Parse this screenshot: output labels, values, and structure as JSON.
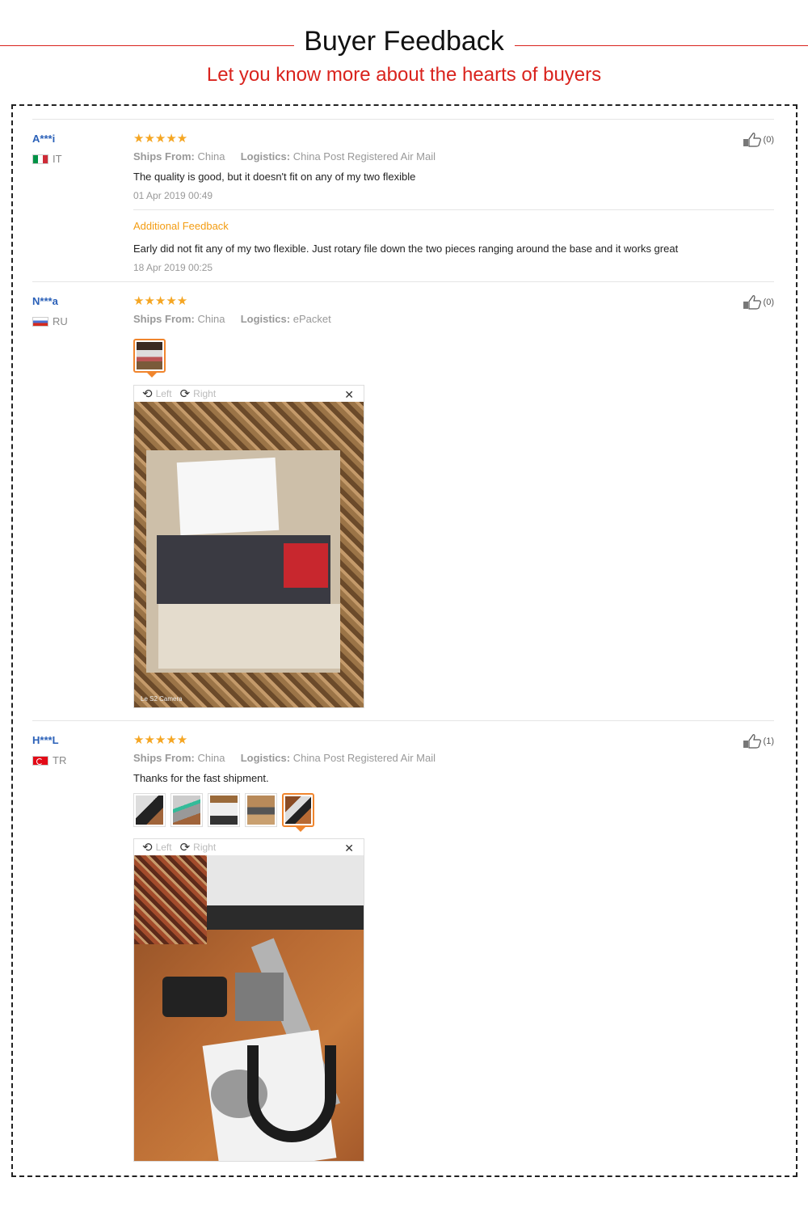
{
  "header": {
    "title": "Buyer Feedback",
    "subtitle": "Let you know more about the hearts of buyers"
  },
  "colors": {
    "accent": "#d9231d",
    "star": "#f5a623",
    "link": "#2a60b8",
    "additional": "#f39c12"
  },
  "reviews": [
    {
      "user": "A***i",
      "country": "IT",
      "stars": "★★★★★",
      "rating": 5,
      "ships_from_label": "Ships From:",
      "ships_from": "China",
      "logistics_label": "Logistics:",
      "logistics": "China Post Registered Air Mail",
      "text": "The quality is good, but it doesn't fit on any of my two flexible",
      "date": "01 Apr 2019 00:49",
      "additional_label": "Additional Feedback",
      "additional_text": "Early did not fit any of my two flexible. Just rotary file down the two pieces ranging around the base and it works great",
      "additional_date": "18 Apr 2019 00:25",
      "likes": "(0)"
    },
    {
      "user": "N***a",
      "country": "RU",
      "stars": "★★★★★",
      "rating": 5,
      "ships_from_label": "Ships From:",
      "ships_from": "China",
      "logistics_label": "Logistics:",
      "logistics": "ePacket",
      "likes": "(0)",
      "viewer": {
        "left": "Left",
        "right": "Right",
        "watermark": "Le S2 Camera"
      }
    },
    {
      "user": "H***L",
      "country": "TR",
      "stars": "★★★★★",
      "rating": 5,
      "ships_from_label": "Ships From:",
      "ships_from": "China",
      "logistics_label": "Logistics:",
      "logistics": "China Post Registered Air Mail",
      "text": "Thanks for the fast shipment.",
      "likes": "(1)",
      "viewer": {
        "left": "Left",
        "right": "Right"
      }
    }
  ],
  "icons": {
    "like": "thumbs-up-icon",
    "rotate_left": "rotate-left-icon",
    "rotate_right": "rotate-right-icon",
    "close": "close-icon"
  }
}
